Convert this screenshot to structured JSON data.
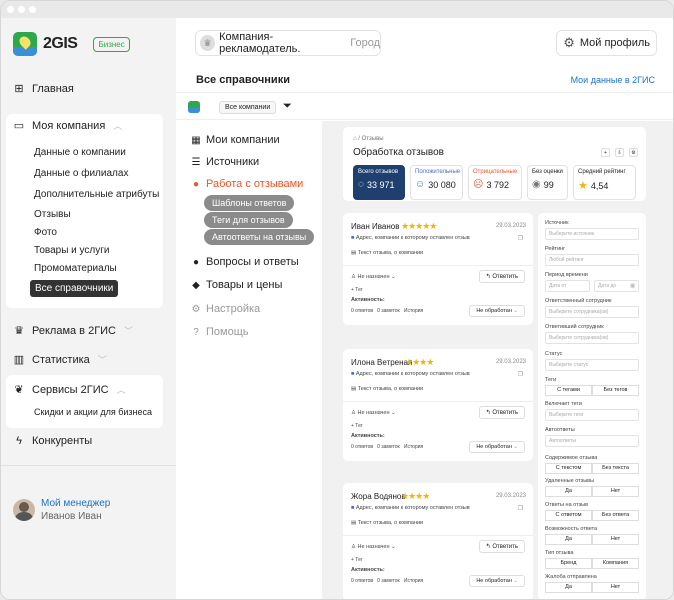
{
  "logo": {
    "text": "2GIS",
    "badge": "Бизнес"
  },
  "sidebar": {
    "home": "Главная",
    "company": "Моя компания",
    "company_items": [
      "Данные о компании",
      "Данные о филиалах",
      "Дополнительные атрибуты",
      "Отзывы",
      "Фото",
      "Товары и услуги",
      "Промоматериалы"
    ],
    "active_item": "Все справочники",
    "ads": "Реклама в 2ГИС",
    "stats": "Статистика",
    "services": "Сервисы 2ГИС",
    "services_items": [
      "Скидки и акции для бизнеса"
    ],
    "competitors": "Конкуренты",
    "manager_label": "Мой менеджер",
    "manager_name": "Иванов Иван"
  },
  "topbar": {
    "company": "Компания-рекламодатель.",
    "city": "Город",
    "profile": "Мой профиль"
  },
  "page": {
    "title": "Все справочники",
    "link": "Мои данные в 2ГИС",
    "filter_chip": "Все компании"
  },
  "menu": {
    "my_companies": "Мои компании",
    "sources": "Источники",
    "reviews_work": "Работа с отзывами",
    "pills": [
      "Шаблоны ответов",
      "Теги для отзывов",
      "Автоответы на отзывы"
    ],
    "qa": "Вопросы и ответы",
    "goods": "Товары и цены",
    "settings": "Настройка",
    "help": "Помощь"
  },
  "header": {
    "breadcrumb": "Отзывы",
    "title": "Обработка отзывов",
    "stats": [
      {
        "label": "Всего отзывов",
        "value": "33 971",
        "icon": "chat-icon"
      },
      {
        "label": "Положительные",
        "value": "30 080",
        "icon": "smile-icon"
      },
      {
        "label": "Отрицательные",
        "value": "3 792",
        "icon": "sad-icon"
      },
      {
        "label": "Без оценки",
        "value": "99",
        "icon": "neutral-icon"
      },
      {
        "label": "Средний рейтинг",
        "value": "4,54",
        "icon": "star-icon"
      }
    ]
  },
  "reviews": [
    {
      "name": "Иван Иванов",
      "stars": "★★★★★",
      "date": "29.03.2023",
      "address": "Адрес, компании к которому оставлен отзыв",
      "text": "Текст отзыва, о компании",
      "assign": "Не назначен",
      "tag": "+ Тег",
      "reply": "Ответить",
      "activity": "Активность:",
      "counts": "0 ответов   0 заметок   История",
      "status": "Не обработан"
    },
    {
      "name": "Илона Ветреная",
      "stars": "★★★★",
      "date": "29.03.2023",
      "address": "Адрес, компании к которому оставлен отзыв",
      "text": "Текст отзыва, о компании",
      "assign": "Не назначен",
      "tag": "+ Тег",
      "reply": "Ответить",
      "activity": "Активность:",
      "counts": "0 ответов   0 заметок   История",
      "status": "Не обработан"
    },
    {
      "name": "Жора Водянов",
      "stars": "★★★★",
      "date": "29.03.2023",
      "address": "Адрес, компании к которому оставлен отзыв",
      "text": "Текст отзыва, о компании",
      "assign": "Не назначен",
      "tag": "+ Тег",
      "reply": "Ответить",
      "activity": "Активность:",
      "counts": "0 ответов   0 заметок   История",
      "status": "Не обработан"
    }
  ],
  "filters": {
    "source": "Источник",
    "source_ph": "Выберите источник",
    "rating": "Рейтинг",
    "rating_ph": "Любой рейтинг",
    "period": "Период времени",
    "period_from": "Дата от",
    "period_to": "Дата до",
    "employee": "Ответственный сотрудник",
    "employee_ph": "Выберите сотрудника(ов)",
    "answerer": "Ответивший сотрудник",
    "answerer_ph": "Выберите сотрудника(ов)",
    "status": "Статус",
    "status_ph": "Выберите статус",
    "tags": "Теги",
    "tags_with": "С тегами",
    "tags_without": "Без тегов",
    "incl_tags": "Включает теги",
    "incl_tags_ph": "Выберите теги",
    "auto": "Автоответы",
    "auto_ph": "Автоответы",
    "content": "Содержимое отзыва",
    "content_with": "С текстом",
    "content_without": "Без текста",
    "deleted": "Удаленные отзывы",
    "yes": "Да",
    "no": "Нет",
    "answers": "Ответы на отзыв",
    "answers_with": "С ответом",
    "answers_without": "Без ответа",
    "possible": "Возможность ответа",
    "type": "Тип отзыва",
    "type_brand": "Бренд",
    "type_company": "Компания",
    "complaint": "Жалоба отправлена"
  },
  "colors": {
    "accent": "#e8572a",
    "brand": "#2ea84a",
    "dark_stat": "#1f3f6e"
  }
}
